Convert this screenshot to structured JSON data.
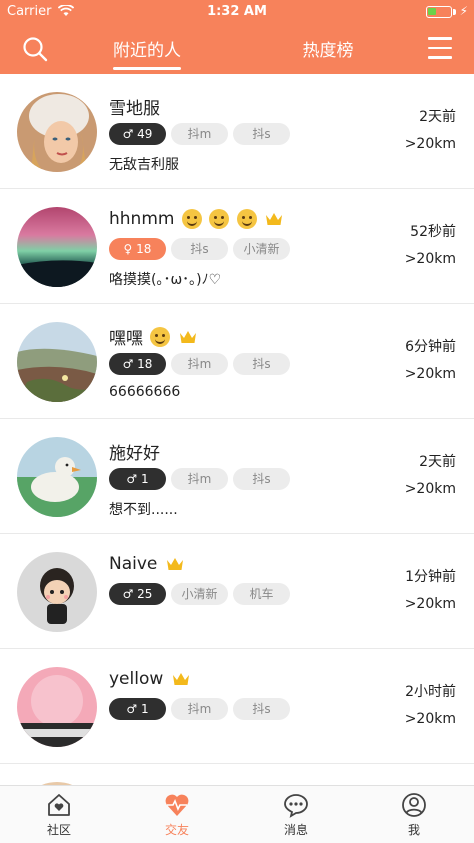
{
  "status_bar": {
    "carrier": "Carrier",
    "time": "1:32 AM"
  },
  "nav": {
    "tabs": [
      {
        "label": "附近的人",
        "active": true
      },
      {
        "label": "热度榜",
        "active": false
      }
    ],
    "accent_color": "#f7825b"
  },
  "users": [
    {
      "name": "雪地服",
      "emojis": [],
      "crown": false,
      "gender": "male",
      "gender_symbol": "♂",
      "age": "49",
      "tags": [
        "抖m",
        "抖s"
      ],
      "signature": "无敌吉利服",
      "time": "2天前",
      "distance": ">20km"
    },
    {
      "name": "hhnmm",
      "emojis": [
        "dizzy-face-emoji",
        "smile-emoji",
        "smile-emoji"
      ],
      "crown": true,
      "gender": "female",
      "gender_symbol": "♀",
      "age": "18",
      "tags": [
        "抖s",
        "小清新"
      ],
      "signature": "咯摸摸(｡･ω･｡)ﾉ♡",
      "time": "52秒前",
      "distance": ">20km"
    },
    {
      "name": "嘿嘿",
      "emojis": [
        "grin-emoji"
      ],
      "crown": true,
      "gender": "male",
      "gender_symbol": "♂",
      "age": "18",
      "tags": [
        "抖m",
        "抖s"
      ],
      "signature": "66666666",
      "time": "6分钟前",
      "distance": ">20km"
    },
    {
      "name": "施好好",
      "emojis": [],
      "crown": false,
      "gender": "male",
      "gender_symbol": "♂",
      "age": "1",
      "tags": [
        "抖m",
        "抖s"
      ],
      "signature": "想不到......",
      "time": "2天前",
      "distance": ">20km"
    },
    {
      "name": "Naive",
      "emojis": [],
      "crown": true,
      "gender": "male",
      "gender_symbol": "♂",
      "age": "25",
      "tags": [
        "小清新",
        "机车"
      ],
      "signature": "",
      "time": "1分钟前",
      "distance": ">20km"
    },
    {
      "name": "yellow",
      "emojis": [],
      "crown": true,
      "gender": "male",
      "gender_symbol": "♂",
      "age": "1",
      "tags": [
        "抖m",
        "抖s"
      ],
      "signature": "",
      "time": "2小时前",
      "distance": ">20km"
    }
  ],
  "tab_bar": [
    {
      "label": "社区",
      "icon": "house-heart-icon",
      "active": false
    },
    {
      "label": "交友",
      "icon": "heartbeat-icon",
      "active": true
    },
    {
      "label": "消息",
      "icon": "chat-bubble-icon",
      "active": false
    },
    {
      "label": "我",
      "icon": "user-icon",
      "active": false
    }
  ]
}
